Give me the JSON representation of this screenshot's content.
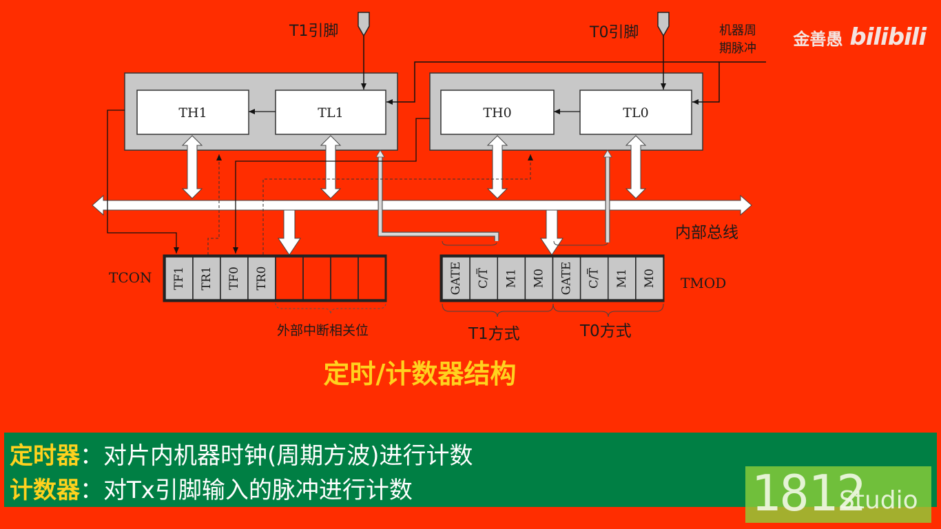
{
  "watermark": {
    "author": "金善愚",
    "logo": "bilibili",
    "studio_number": "1812",
    "studio_word": "Studio"
  },
  "inputs": {
    "t1_pin": "T1引脚",
    "t0_pin": "T0引脚",
    "machine_cycle": [
      "机器周",
      "期脉冲"
    ]
  },
  "registers": {
    "th1": "TH1",
    "tl1": "TL1",
    "th0": "TH0",
    "tl0": "TL0"
  },
  "bus_label": "内部总线",
  "tcon": {
    "label": "TCON",
    "bits": [
      "TF1",
      "TR1",
      "TF0",
      "TR0",
      "",
      "",
      "",
      ""
    ],
    "note": "外部中断相关位"
  },
  "tmod": {
    "label": "TMOD",
    "bits": [
      "GATE",
      "C/T",
      "M1",
      "M0",
      "GATE",
      "C/T",
      "M1",
      "M0"
    ],
    "t1_mode": "T1方式",
    "t0_mode": "T0方式"
  },
  "title": "定时/计数器结构",
  "definitions": [
    {
      "term": "定时器",
      "sep": "：",
      "text": "对片内机器时钟(周期方波)进行计数"
    },
    {
      "term": "计数器",
      "sep": "：",
      "text": "对Tx引脚输入的脉冲进行计数"
    }
  ],
  "colors": {
    "background": "#ff2d00",
    "title": "#ffd21e",
    "band": "#007f44",
    "panel": "#c8c8c8"
  }
}
